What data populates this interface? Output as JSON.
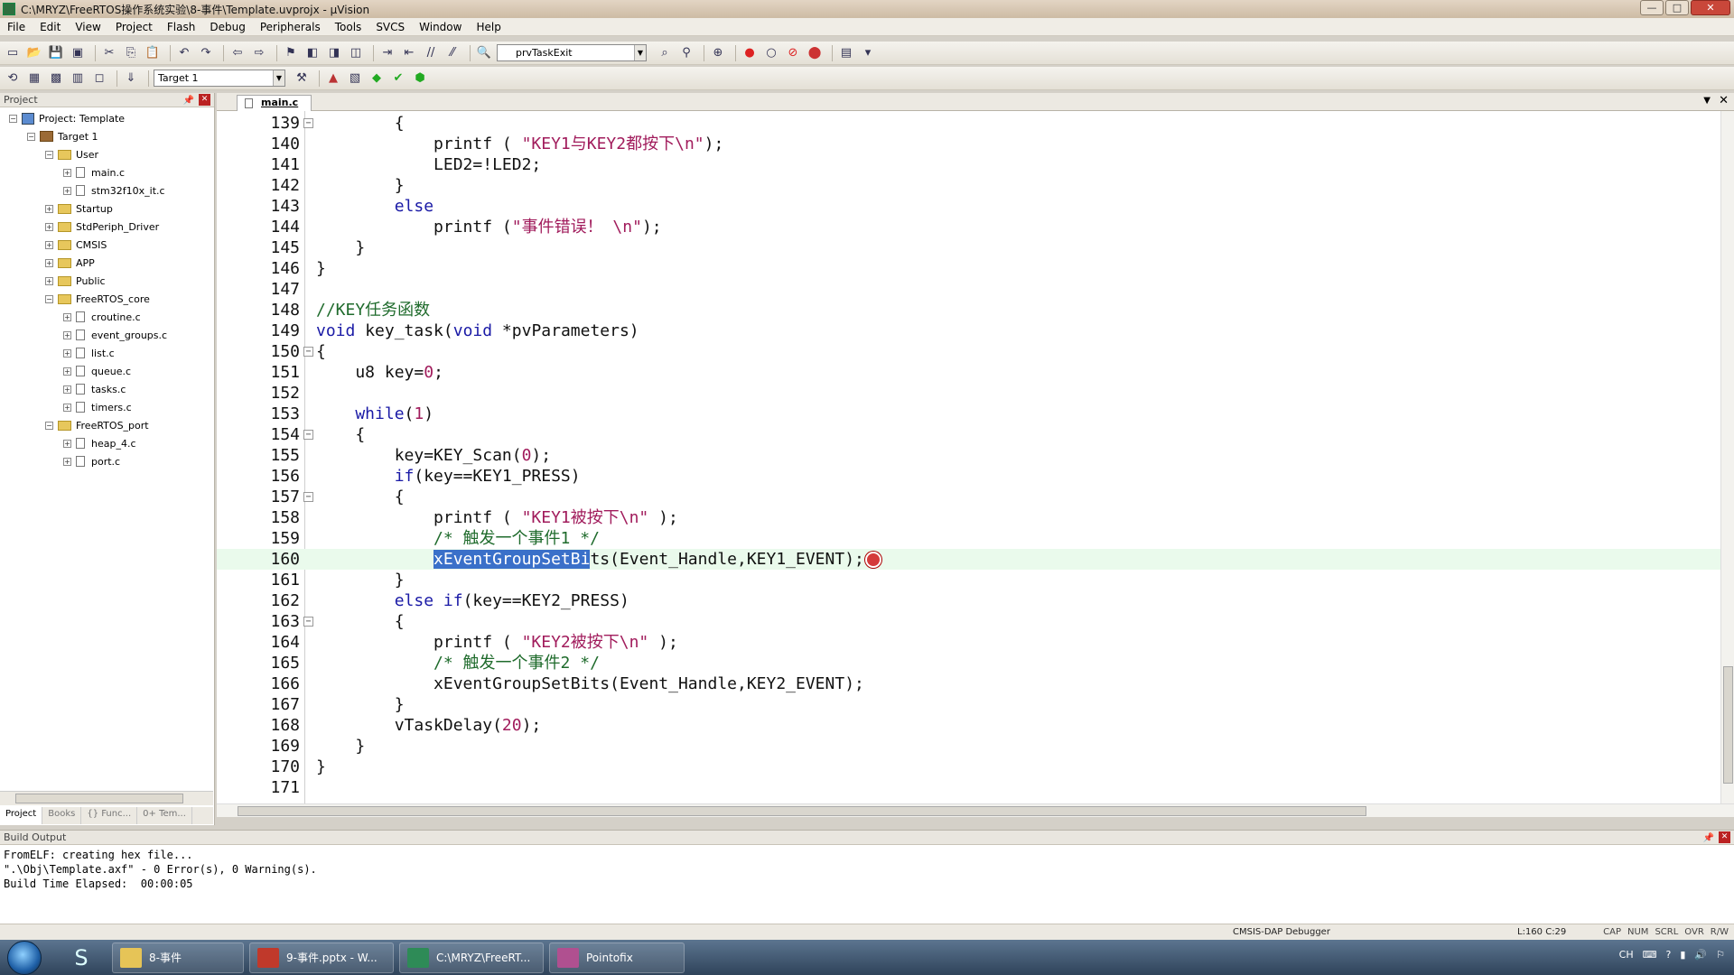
{
  "window": {
    "title": "C:\\MRYZ\\FreeRTOS操作系统实验\\8-事件\\Template.uvprojx - µVision",
    "controls": [
      "—",
      "□",
      "✕"
    ]
  },
  "menu": [
    "File",
    "Edit",
    "View",
    "Project",
    "Flash",
    "Debug",
    "Peripherals",
    "Tools",
    "SVCS",
    "Window",
    "Help"
  ],
  "toolbar": {
    "function_combo": "prvTaskExit",
    "target_combo": "Target 1"
  },
  "project_panel": {
    "title": "Project",
    "tree": [
      {
        "label": "Project: Template",
        "level": 0,
        "kind": "project",
        "expander": "−"
      },
      {
        "label": "Target 1",
        "level": 1,
        "kind": "target",
        "expander": "−"
      },
      {
        "label": "User",
        "level": 2,
        "kind": "folder",
        "expander": "−"
      },
      {
        "label": "main.c",
        "level": 3,
        "kind": "file",
        "expander": "+"
      },
      {
        "label": "stm32f10x_it.c",
        "level": 3,
        "kind": "file",
        "expander": "+"
      },
      {
        "label": "Startup",
        "level": 2,
        "kind": "folder",
        "expander": "+"
      },
      {
        "label": "StdPeriph_Driver",
        "level": 2,
        "kind": "folder",
        "expander": "+"
      },
      {
        "label": "CMSIS",
        "level": 2,
        "kind": "folder",
        "expander": "+"
      },
      {
        "label": "APP",
        "level": 2,
        "kind": "folder",
        "expander": "+"
      },
      {
        "label": "Public",
        "level": 2,
        "kind": "folder",
        "expander": "+"
      },
      {
        "label": "FreeRTOS_core",
        "level": 2,
        "kind": "folder",
        "expander": "−"
      },
      {
        "label": "croutine.c",
        "level": 3,
        "kind": "file",
        "expander": "+"
      },
      {
        "label": "event_groups.c",
        "level": 3,
        "kind": "file",
        "expander": "+"
      },
      {
        "label": "list.c",
        "level": 3,
        "kind": "file",
        "expander": "+"
      },
      {
        "label": "queue.c",
        "level": 3,
        "kind": "file",
        "expander": "+"
      },
      {
        "label": "tasks.c",
        "level": 3,
        "kind": "file",
        "expander": "+"
      },
      {
        "label": "timers.c",
        "level": 3,
        "kind": "file",
        "expander": "+"
      },
      {
        "label": "FreeRTOS_port",
        "level": 2,
        "kind": "folder",
        "expander": "−"
      },
      {
        "label": "heap_4.c",
        "level": 3,
        "kind": "file",
        "expander": "+"
      },
      {
        "label": "port.c",
        "level": 3,
        "kind": "file",
        "expander": "+"
      }
    ],
    "tabs": [
      "Project",
      "Books",
      "{} Func...",
      "0+ Tem..."
    ]
  },
  "editor": {
    "tab": "main.c",
    "current_line": 160,
    "lines": [
      {
        "n": 139,
        "fold": "−",
        "tokens": [
          [
            "",
            "        {"
          ]
        ]
      },
      {
        "n": 140,
        "fold": "",
        "tokens": [
          [
            "",
            "            printf ( "
          ],
          [
            "str",
            "\"KEY1与KEY2都按下\\n\""
          ],
          [
            "",
            ");"
          ]
        ]
      },
      {
        "n": 141,
        "fold": "",
        "tokens": [
          [
            "",
            "            LED2=!LED2;"
          ]
        ]
      },
      {
        "n": 142,
        "fold": "",
        "tokens": [
          [
            "",
            "        }"
          ]
        ]
      },
      {
        "n": 143,
        "fold": "",
        "tokens": [
          [
            "kw",
            "        else"
          ]
        ]
      },
      {
        "n": 144,
        "fold": "",
        "tokens": [
          [
            "",
            "            printf ("
          ],
          [
            "str",
            "\"事件错误！ \\n\""
          ],
          [
            "",
            ");"
          ]
        ]
      },
      {
        "n": 145,
        "fold": "",
        "tokens": [
          [
            "",
            "    }"
          ]
        ]
      },
      {
        "n": 146,
        "fold": "",
        "tokens": [
          [
            "",
            "}"
          ]
        ]
      },
      {
        "n": 147,
        "fold": "",
        "tokens": [
          [
            "",
            ""
          ]
        ]
      },
      {
        "n": 148,
        "fold": "",
        "tokens": [
          [
            "cmt",
            "//KEY任务函数"
          ]
        ]
      },
      {
        "n": 149,
        "fold": "",
        "tokens": [
          [
            "kw",
            "void"
          ],
          [
            "",
            " key_task("
          ],
          [
            "kw",
            "void"
          ],
          [
            "",
            " *pvParameters)"
          ]
        ]
      },
      {
        "n": 150,
        "fold": "−",
        "tokens": [
          [
            "",
            "{"
          ]
        ]
      },
      {
        "n": 151,
        "fold": "",
        "tokens": [
          [
            "",
            "    u8 key="
          ],
          [
            "num",
            "0"
          ],
          [
            "",
            ";"
          ]
        ]
      },
      {
        "n": 152,
        "fold": "",
        "tokens": [
          [
            "",
            ""
          ]
        ]
      },
      {
        "n": 153,
        "fold": "",
        "tokens": [
          [
            "kw",
            "    while"
          ],
          [
            "",
            "("
          ],
          [
            "num",
            "1"
          ],
          [
            "",
            ")"
          ]
        ]
      },
      {
        "n": 154,
        "fold": "−",
        "tokens": [
          [
            "",
            "    {"
          ]
        ]
      },
      {
        "n": 155,
        "fold": "",
        "tokens": [
          [
            "",
            "        key=KEY_Scan("
          ],
          [
            "num",
            "0"
          ],
          [
            "",
            ");"
          ]
        ]
      },
      {
        "n": 156,
        "fold": "",
        "tokens": [
          [
            "kw",
            "        if"
          ],
          [
            "",
            "(key==KEY1_PRESS)"
          ]
        ]
      },
      {
        "n": 157,
        "fold": "−",
        "tokens": [
          [
            "",
            "        {"
          ]
        ]
      },
      {
        "n": 158,
        "fold": "",
        "tokens": [
          [
            "",
            "            printf ( "
          ],
          [
            "str",
            "\"KEY1被按下\\n\""
          ],
          [
            "",
            " );"
          ]
        ]
      },
      {
        "n": 159,
        "fold": "",
        "tokens": [
          [
            "cmt",
            "            /* 触发一个事件1 */"
          ]
        ]
      },
      {
        "n": 160,
        "fold": "",
        "tokens": [
          [
            "",
            "            "
          ],
          [
            "sel",
            "xEventGroupSetBi"
          ],
          [
            "",
            "ts(Event_Handle,KEY1_EVENT);"
          ]
        ]
      },
      {
        "n": 161,
        "fold": "",
        "tokens": [
          [
            "",
            "        }"
          ]
        ]
      },
      {
        "n": 162,
        "fold": "",
        "tokens": [
          [
            "kw",
            "        else if"
          ],
          [
            "",
            "(key==KEY2_PRESS)"
          ]
        ]
      },
      {
        "n": 163,
        "fold": "−",
        "tokens": [
          [
            "",
            "        {"
          ]
        ]
      },
      {
        "n": 164,
        "fold": "",
        "tokens": [
          [
            "",
            "            printf ( "
          ],
          [
            "str",
            "\"KEY2被按下\\n\""
          ],
          [
            "",
            " );"
          ]
        ]
      },
      {
        "n": 165,
        "fold": "",
        "tokens": [
          [
            "cmt",
            "            /* 触发一个事件2 */"
          ]
        ]
      },
      {
        "n": 166,
        "fold": "",
        "tokens": [
          [
            "",
            "            xEventGroupSetBits(Event_Handle,KEY2_EVENT);"
          ]
        ]
      },
      {
        "n": 167,
        "fold": "",
        "tokens": [
          [
            "",
            "        }"
          ]
        ]
      },
      {
        "n": 168,
        "fold": "",
        "tokens": [
          [
            "",
            "        vTaskDelay("
          ],
          [
            "num",
            "20"
          ],
          [
            "",
            ");"
          ]
        ]
      },
      {
        "n": 169,
        "fold": "",
        "tokens": [
          [
            "",
            "    }"
          ]
        ]
      },
      {
        "n": 170,
        "fold": "",
        "tokens": [
          [
            "",
            "}"
          ]
        ]
      },
      {
        "n": 171,
        "fold": "",
        "tokens": [
          [
            "",
            ""
          ]
        ]
      }
    ]
  },
  "build_output": {
    "title": "Build Output",
    "lines": [
      "FromELF: creating hex file...",
      "\".\\Obj\\Template.axf\" - 0 Error(s), 0 Warning(s).",
      "Build Time Elapsed:  00:00:05"
    ]
  },
  "status": {
    "debugger": "CMSIS-DAP Debugger",
    "position": "L:160 C:29",
    "flags": [
      "CAP",
      "NUM",
      "SCRL",
      "OVR",
      "R/W"
    ]
  },
  "taskbar": {
    "items": [
      {
        "label": "8-事件",
        "color": "#e6c457"
      },
      {
        "label": "9-事件.pptx - W...",
        "color": "#c0392b"
      },
      {
        "label": "C:\\MRYZ\\FreeRT...",
        "color": "#2e8b57"
      },
      {
        "label": "Pointofix",
        "color": "#b05090"
      }
    ],
    "tray_lang": "CH"
  },
  "colors": {
    "keyword": "#1a1aa6",
    "string": "#a11c5c",
    "comment": "#1f6b2c",
    "selection": "#3a70c9",
    "current_line": "#eafaec"
  }
}
